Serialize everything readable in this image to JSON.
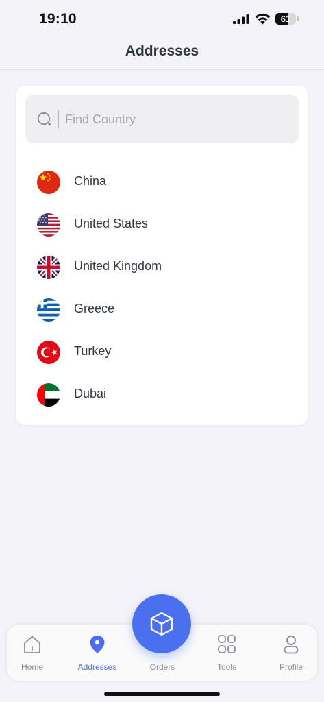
{
  "status_bar": {
    "time": "19:10",
    "battery_level": "61",
    "battery_fraction": 0.61,
    "icons": [
      "signal-icon",
      "wifi-icon",
      "battery-icon"
    ]
  },
  "header": {
    "title": "Addresses"
  },
  "search": {
    "placeholder": "Find Country",
    "value": "",
    "icon": "search-icon"
  },
  "countries": [
    {
      "name": "China",
      "flag": "china-flag-icon"
    },
    {
      "name": "United States",
      "flag": "us-flag-icon"
    },
    {
      "name": "United Kingdom",
      "flag": "uk-flag-icon"
    },
    {
      "name": "Greece",
      "flag": "greece-flag-icon"
    },
    {
      "name": "Turkey",
      "flag": "turkey-flag-icon"
    },
    {
      "name": "Dubai",
      "flag": "uae-flag-icon"
    }
  ],
  "tab_bar": {
    "tabs": [
      {
        "label": "Home",
        "icon": "home-icon",
        "active": false
      },
      {
        "label": "Addresses",
        "icon": "location-pin-icon",
        "active": true
      },
      {
        "label": "Orders",
        "icon": "box-icon",
        "active": false
      },
      {
        "label": "Tools",
        "icon": "grid-icon",
        "active": false
      },
      {
        "label": "Profile",
        "icon": "user-icon",
        "active": false
      }
    ]
  },
  "colors": {
    "accent": "#4a6cf7",
    "fab": "#4a70f0",
    "background": "#f3f3f8",
    "card": "#ffffff",
    "text": "#333a47",
    "inactive": "#8a8d96"
  }
}
